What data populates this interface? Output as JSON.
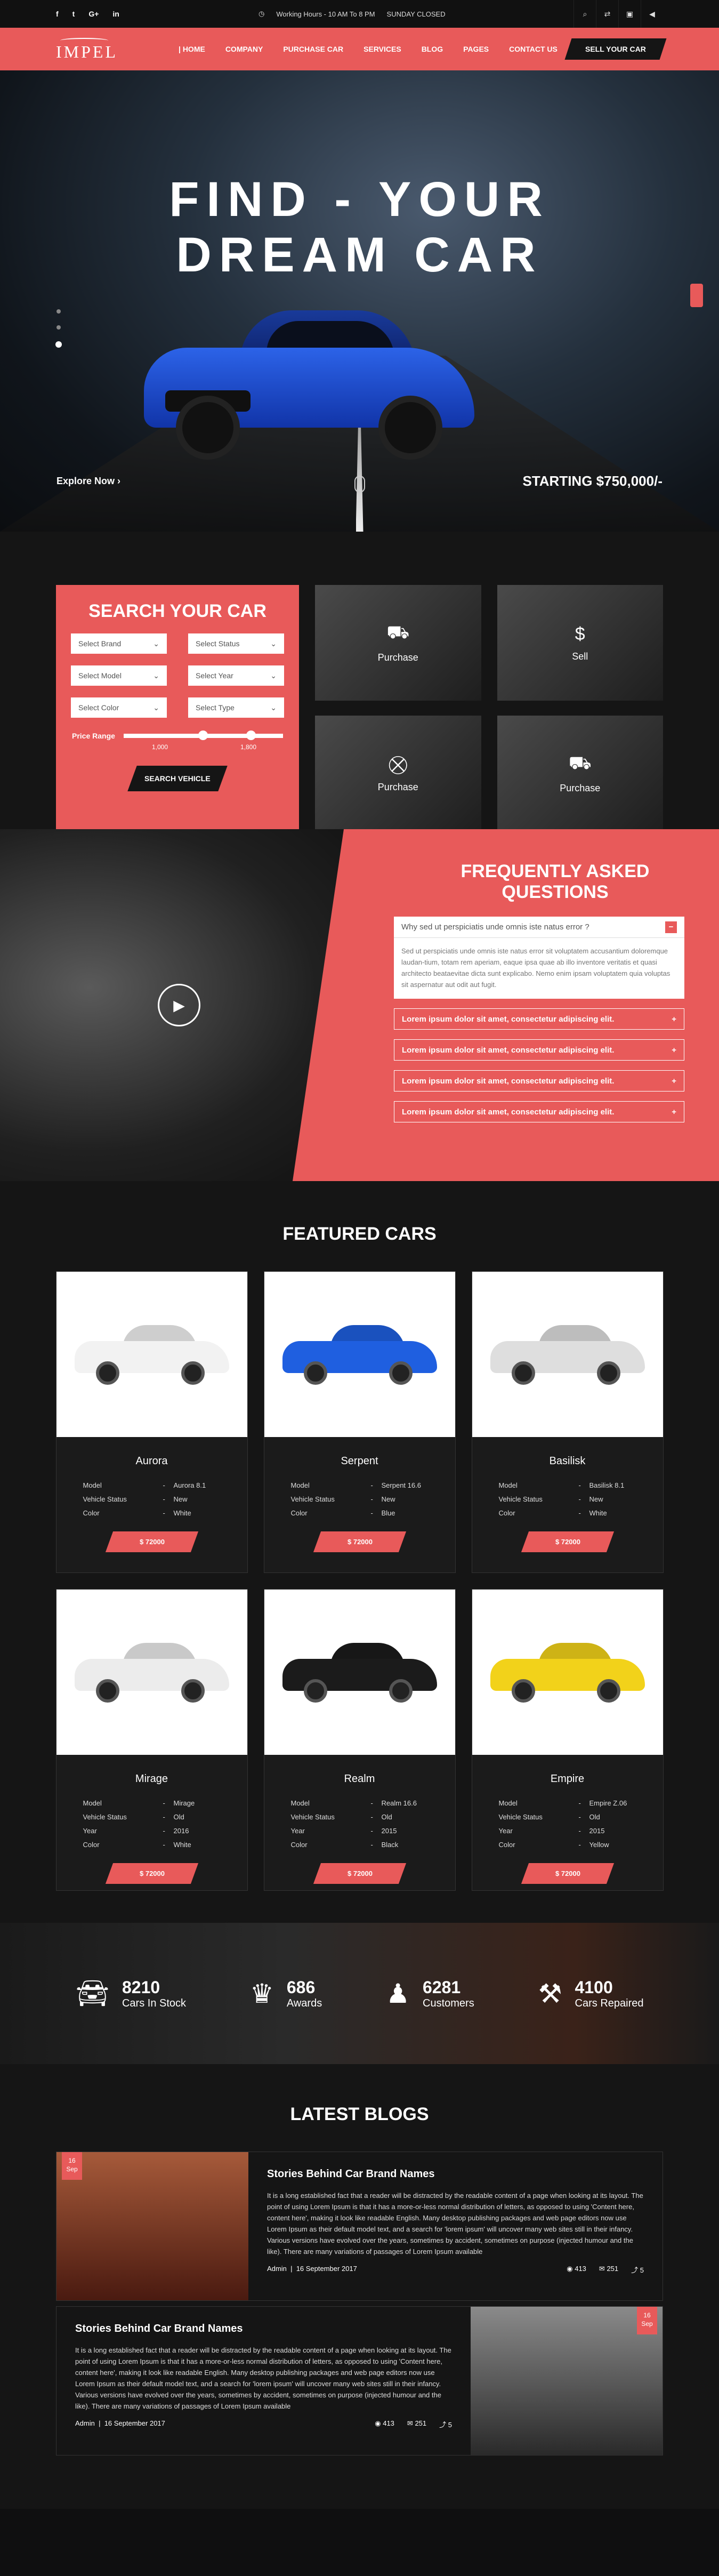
{
  "topbar": {
    "social": [
      "f",
      "t",
      "G+",
      "in"
    ],
    "hours": "Working Hours - 10 AM To 8 PM",
    "closed": "SUNDAY CLOSED",
    "tools": [
      "search",
      "compare",
      "cart",
      "volume"
    ]
  },
  "nav": {
    "logo": "IMPEL",
    "items": [
      "HOME",
      "COMPANY",
      "PURCHASE CAR",
      "SERVICES",
      "BLOG",
      "PAGES",
      "CONTACT US"
    ],
    "sell": "SELL YOUR CAR"
  },
  "hero": {
    "title1": "FIND - YOUR",
    "title2": "DREAM CAR",
    "explore": "Explore Now",
    "starting": "STARTING $750,000/-"
  },
  "search": {
    "title": "SEARCH YOUR CAR",
    "selects": [
      "Select Brand",
      "Select Status",
      "Select Model",
      "Select Year",
      "Select Color",
      "Select Type"
    ],
    "price_label": "Price Range",
    "range_min": "1,000",
    "range_max": "1,800",
    "button": "SEARCH VEHICLE"
  },
  "services": [
    "Purchase",
    "Sell",
    "Purchase",
    "Purchase"
  ],
  "faq": {
    "title": "FREQUENTLY ASKED QUESTIONS",
    "open_q": "Why sed ut perspiciatis unde omnis iste natus error ?",
    "open_a": "Sed ut perspiciatis unde omnis iste natus error sit voluptatem accusantium doloremque laudan-tium, totam rem aperiam, eaque ipsa quae ab illo inventore veritatis et quasi architecto beataevitae dicta sunt explicabo. Nemo enim ipsam voluptatem quia voluptas sit aspernatur aut odit aut fugit.",
    "closed": [
      "Lorem ipsum dolor sit amet, consectetur adipiscing elit.",
      "Lorem ipsum dolor sit amet, consectetur adipiscing elit.",
      "Lorem ipsum dolor sit amet, consectetur adipiscing elit.",
      "Lorem ipsum dolor sit amet, consectetur adipiscing elit."
    ]
  },
  "featured": {
    "title": "FEATURED CARS",
    "cars": [
      {
        "name": "Aurora",
        "model": "Aurora 8.1",
        "status": "New",
        "year": "",
        "color": "White",
        "price": "$ 72000",
        "car_color": "#f2f2f2"
      },
      {
        "name": "Serpent",
        "model": "Serpent 16.6",
        "status": "New",
        "year": "",
        "color": "Blue",
        "price": "$ 72000",
        "car_color": "#1f5fe0"
      },
      {
        "name": "Basilisk",
        "model": "Basilisk 8.1",
        "status": "New",
        "year": "",
        "color": "White",
        "price": "$ 72000",
        "car_color": "#dedede"
      },
      {
        "name": "Mirage",
        "model": "Mirage",
        "status": "Old",
        "year": "2016",
        "color": "White",
        "price": "$ 72000",
        "car_color": "#ececec"
      },
      {
        "name": "Realm",
        "model": "Realm 16.6",
        "status": "Old",
        "year": "2015",
        "color": "Black",
        "price": "$ 72000",
        "car_color": "#1b1b1b"
      },
      {
        "name": "Empire",
        "model": "Empire Z.06",
        "status": "Old",
        "year": "2015",
        "color": "Yellow",
        "price": "$ 72000",
        "car_color": "#f2d21a"
      }
    ],
    "labels": {
      "model": "Model",
      "status": "Vehicle Status",
      "year": "Year",
      "color": "Color"
    }
  },
  "stats": [
    {
      "num": "8210",
      "label": "Cars In Stock",
      "icon": "car-icon"
    },
    {
      "num": "686",
      "label": "Awards",
      "icon": "trophy-icon"
    },
    {
      "num": "6281",
      "label": "Customers",
      "icon": "user-icon"
    },
    {
      "num": "4100",
      "label": "Cars Repaired",
      "icon": "repair-icon"
    }
  ],
  "blogs": {
    "title": "LATEST BLOGS",
    "posts": [
      {
        "day": "16",
        "month": "Sep",
        "title": "Stories Behind Car Brand Names",
        "body": "It is a long established fact that a reader will be distracted by the readable content of a page when looking at its layout. The point of using Lorem Ipsum is that it has a more-or-less normal distribution of letters, as opposed to using 'Content here, content here', making it look like readable English. Many desktop publishing packages and web page editors now use Lorem Ipsum as their default model text, and a search for 'lorem ipsum' will uncover many web sites still in their infancy. Various versions have evolved over the years, sometimes by accident, sometimes on purpose (injected humour and the like). There are many variations of passages of Lorem Ipsum available",
        "author": "Admin",
        "date": "16 September 2017",
        "views": "413",
        "comments": "251",
        "shares": "5"
      },
      {
        "day": "16",
        "month": "Sep",
        "title": "Stories Behind Car Brand Names",
        "body": "It is a long established fact that a reader will be distracted by the readable content of a page when looking at its layout. The point of using Lorem Ipsum is that it has a more-or-less normal distribution of letters, as opposed to using 'Content here, content here', making it look like readable English. Many desktop publishing packages and web page editors now use Lorem Ipsum as their default model text, and a search for 'lorem ipsum' will uncover many web sites still in their infancy. Various versions have evolved over the years, sometimes by accident, sometimes on purpose (injected humour and the like). There are many variations of passages of Lorem Ipsum available",
        "author": "Admin",
        "date": "16 September 2017",
        "views": "413",
        "comments": "251",
        "shares": "5"
      }
    ]
  },
  "colors": {
    "accent": "#e85a5a",
    "dark": "#151515"
  }
}
